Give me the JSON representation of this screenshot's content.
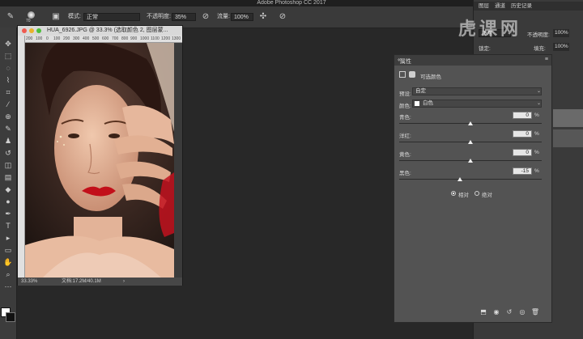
{
  "app": {
    "title": "Adobe Photoshop CC 2017"
  },
  "options_bar": {
    "mode_label": "模式:",
    "mode_value": "正常",
    "opacity_label": "不透明度:",
    "opacity_value": "35%",
    "flow_label": "流量:",
    "flow_value": "100%",
    "brush_size": "70"
  },
  "document": {
    "title": "HUA_6926.JPG @ 33.3% (选取颜色 2, 图层蒙...",
    "zoom": "33.33%",
    "file_info": "文档:17.2M/40.1M",
    "ruler_ticks": [
      "200",
      "100",
      "0",
      "100",
      "200",
      "300",
      "400",
      "500",
      "600",
      "700",
      "800",
      "900",
      "1000",
      "1100",
      "1200",
      "1300"
    ]
  },
  "right_panel": {
    "tabs": [
      "图层",
      "通道",
      "历史记录"
    ],
    "opacity_label": "不透明度:",
    "opacity_value": "100%",
    "fill_label": "填充:",
    "fill_value": "100%",
    "lock_label": "锁定:",
    "blend_value": "正常"
  },
  "properties": {
    "tab": "属性",
    "adjustment_title": "可选颜色",
    "preset_label": "预设:",
    "preset_value": "自定",
    "color_label": "颜色:",
    "color_value": "白色",
    "sliders": [
      {
        "label": "青色:",
        "value": "0",
        "unit": "%",
        "position": 0.5
      },
      {
        "label": "洋红:",
        "value": "0",
        "unit": "%",
        "position": 0.5
      },
      {
        "label": "黄色:",
        "value": "0",
        "unit": "%",
        "position": 0.5
      },
      {
        "label": "黑色:",
        "value": "-15",
        "unit": "%",
        "position": 0.425
      }
    ],
    "method_relative": "相对",
    "method_absolute": "绝对"
  },
  "watermark": {
    "text": "虎课网"
  },
  "colors": {
    "accent": "#4a8fd8",
    "lip": "#c2101a",
    "background": "#282828"
  }
}
